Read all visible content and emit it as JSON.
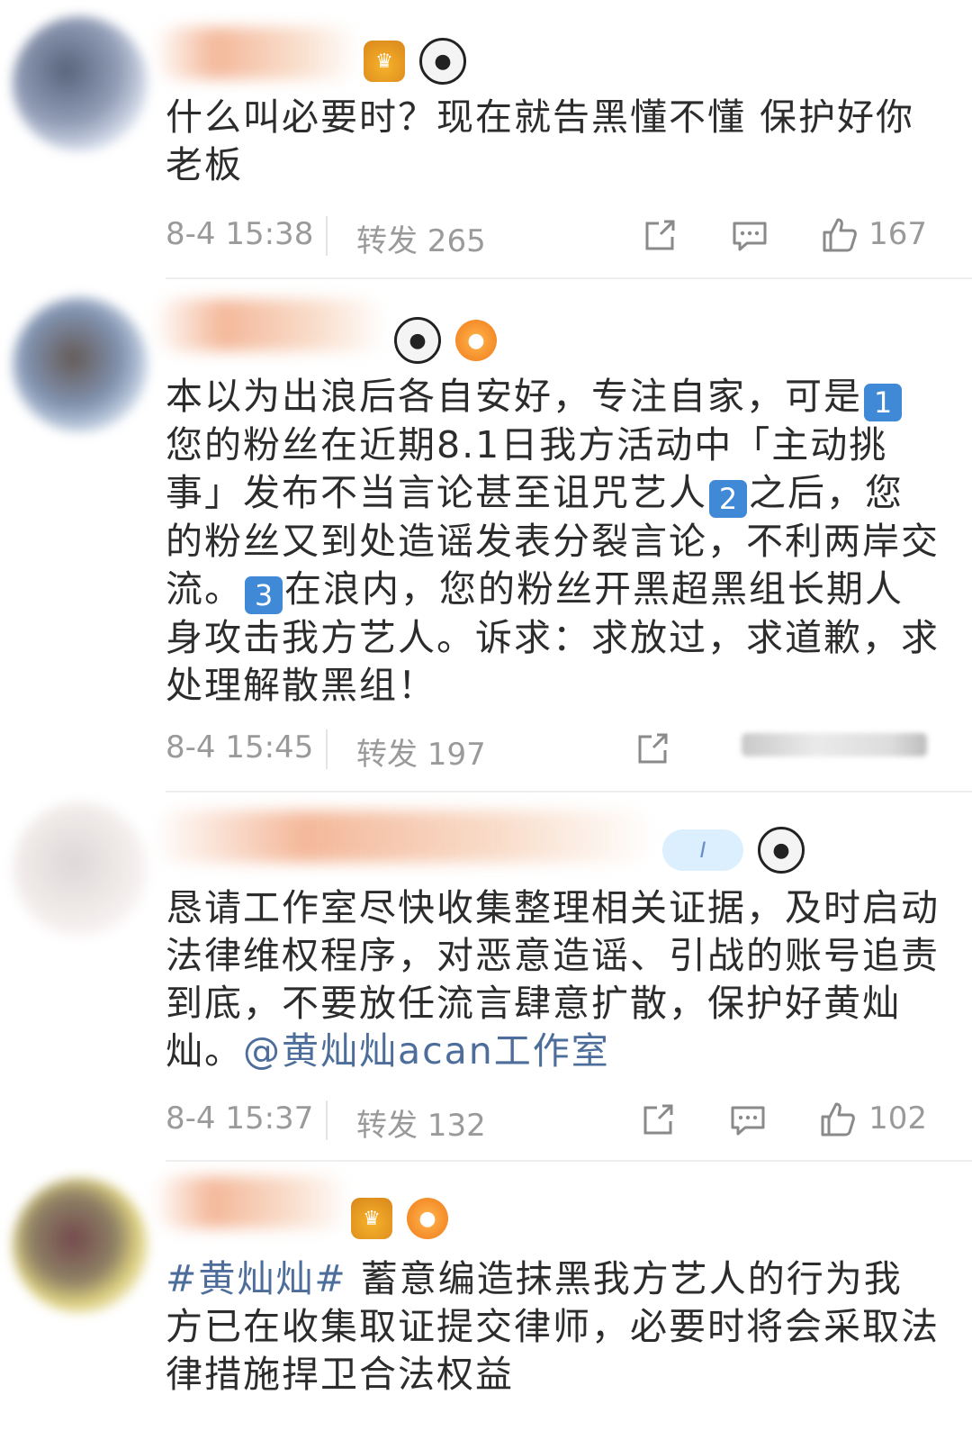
{
  "colors": {
    "text": "#2c2c2c",
    "meta": "#9a9a9a",
    "link": "#4d6e9b",
    "number_badge": "#3f89d6"
  },
  "posts": [
    {
      "body": "什么叫必要时？现在就告黑懂不懂 保护好你老板",
      "time": "8-4 15:38",
      "repost": "转发 265",
      "likes": "167",
      "badges": [
        "crown-badge",
        "panda-badge"
      ]
    },
    {
      "body_parts": [
        "本以为出浪后各自安好，专注自家，可是",
        "1",
        "您的粉丝在近期8.1日我方活动中「主动挑事」发布不当言论甚至诅咒艺人",
        "2",
        "之后，您的粉丝又到处造谣发表分裂言论，不利两岸交流。",
        "3",
        "在浪内，您的粉丝开黑超黑组长期人身攻击我方艺人。诉求：求放过，求道歉，求处理解散黑组！"
      ],
      "time": "8-4 15:45",
      "repost": "转发 197",
      "badges": [
        "panda-badge",
        "fish-badge"
      ]
    },
    {
      "body": "恳请工作室尽快收集整理相关证据，及时启动法律维权程序，对恶意造谣、引战的账号追责到底，不要放任流言肆意扩散，保护好黄灿灿。",
      "mention": "@黄灿灿acan工作室",
      "time": "8-4 15:37",
      "repost": "转发 132",
      "likes": "102",
      "badges": [
        "level-pill-badge",
        "panda-badge"
      ],
      "pill_text": "I"
    },
    {
      "hashtag": "#黄灿灿#",
      "body": " 蓄意编造抹黑我方艺人的行为我方已在收集取证提交律师，必要时将会采取法律措施捍卫合法权益",
      "badges": [
        "crown-badge",
        "fish-badge"
      ]
    }
  ]
}
